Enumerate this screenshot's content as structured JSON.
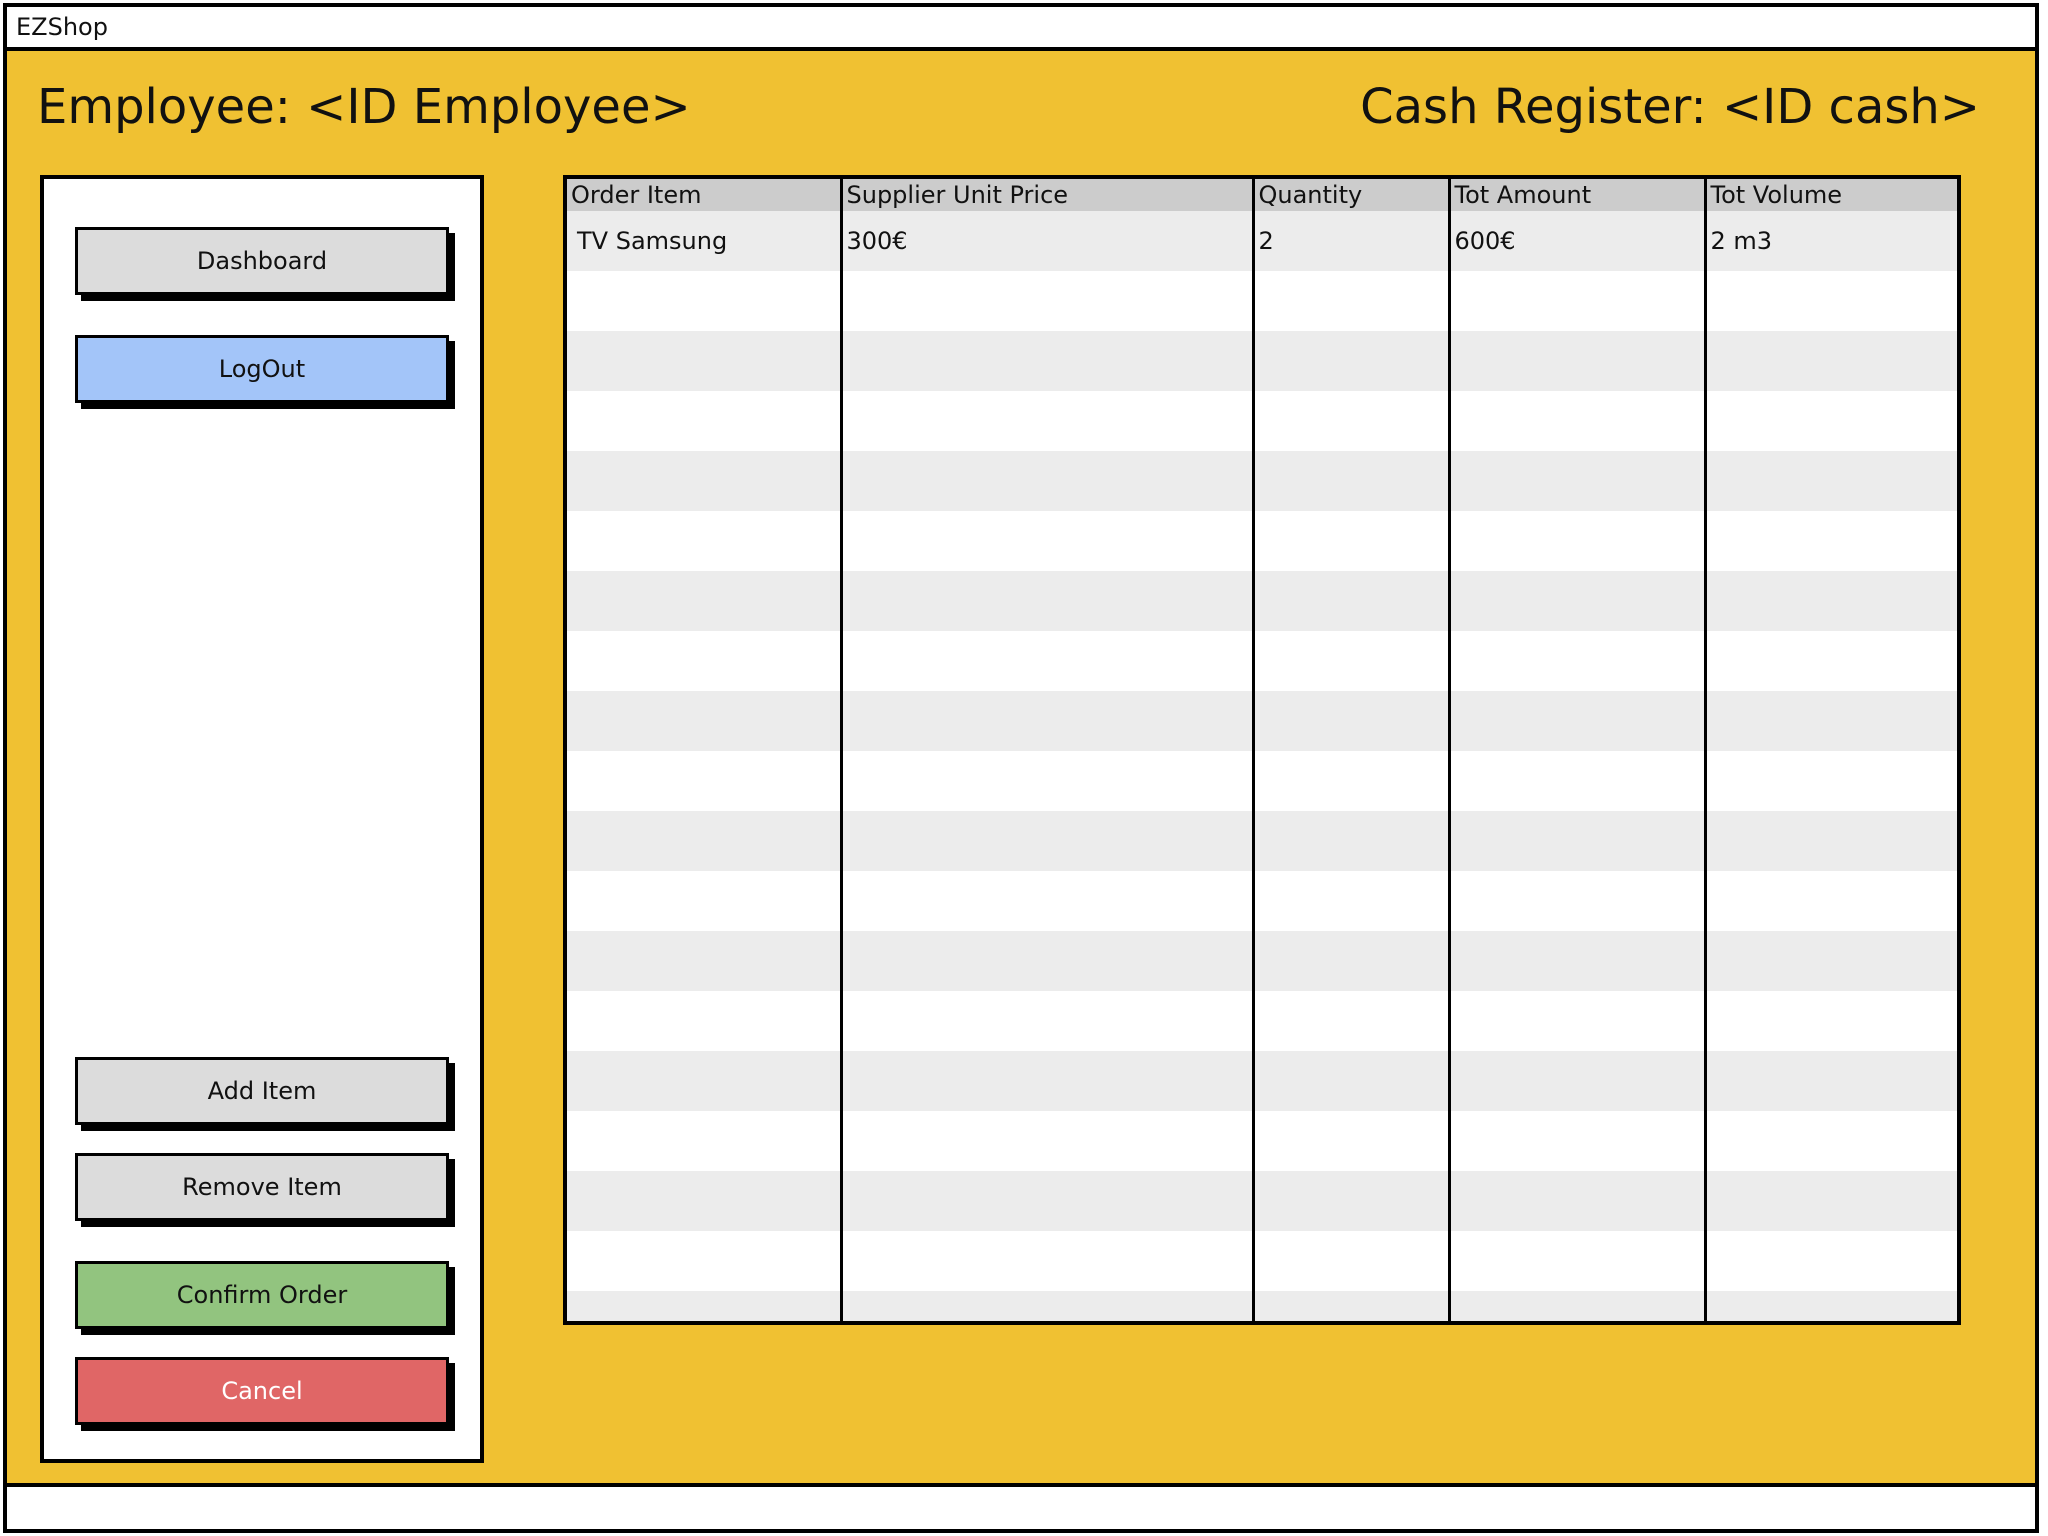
{
  "app": {
    "title": "EZShop"
  },
  "header": {
    "employee_label": "Employee: <ID Employee>",
    "cash_register_label": "Cash Register: <ID cash>"
  },
  "sidebar": {
    "dashboard_label": "Dashboard",
    "logout_label": "LogOut",
    "add_item_label": "Add Item",
    "remove_item_label": "Remove Item",
    "confirm_order_label": "Confirm Order",
    "cancel_label": "Cancel"
  },
  "table": {
    "columns": [
      "Order Item",
      "Supplier Unit Price",
      "Quantity",
      "Tot Amount",
      "Tot Volume"
    ],
    "rows": [
      [
        "TV Samsung",
        "300€",
        "2",
        "600€",
        "2 m3"
      ]
    ]
  },
  "colors": {
    "background": "#F0C132",
    "logout_button": "#a3c5f9",
    "confirm_button": "#92c47f",
    "cancel_button": "#e06666",
    "neutral_button": "#dcdcdc"
  }
}
